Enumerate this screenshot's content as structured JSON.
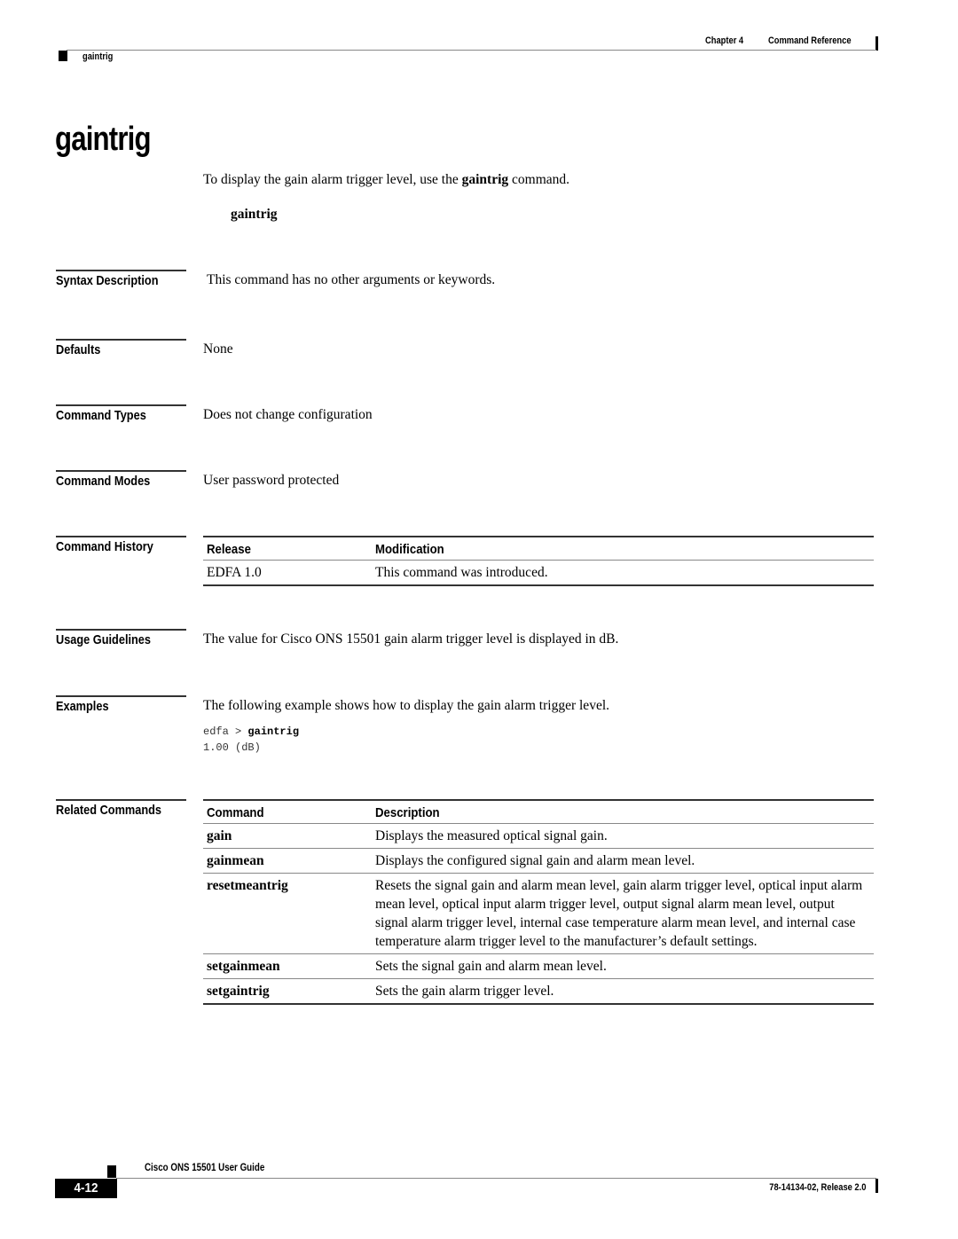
{
  "header": {
    "chapter": "Chapter 4",
    "section": "Command Reference",
    "running_head": "gaintrig"
  },
  "title": "gaintrig",
  "intro": {
    "before": "To display the gain alarm trigger level, use the ",
    "command": "gaintrig",
    "after": " command."
  },
  "syntax": "gaintrig",
  "sections": {
    "syntax_description": {
      "label": "Syntax Description",
      "text": "This command has no other arguments or keywords."
    },
    "defaults": {
      "label": "Defaults",
      "text": "None"
    },
    "command_types": {
      "label": "Command Types",
      "text": "Does not change configuration"
    },
    "command_modes": {
      "label": "Command Modes",
      "text": "User password protected"
    },
    "command_history": {
      "label": "Command History",
      "headers": [
        "Release",
        "Modification"
      ],
      "rows": [
        [
          "EDFA 1.0",
          "This command was introduced."
        ]
      ]
    },
    "usage_guidelines": {
      "label": "Usage Guidelines",
      "text": "The value for Cisco ONS 15501 gain alarm trigger level is displayed in dB."
    },
    "examples": {
      "label": "Examples",
      "text": "The following example shows how to display the gain alarm trigger level.",
      "prompt": "edfa > ",
      "command": "gaintrig",
      "output": "1.00 (dB)"
    },
    "related_commands": {
      "label": "Related Commands",
      "headers": [
        "Command",
        "Description"
      ],
      "rows": [
        [
          "gain",
          "Displays the measured optical signal gain."
        ],
        [
          "gainmean",
          "Displays the configured signal gain and alarm mean level."
        ],
        [
          "resetmeantrig",
          "Resets the signal gain and alarm mean level, gain alarm trigger level, optical input alarm mean level, optical input alarm trigger level, output signal alarm mean level, output signal alarm trigger level, internal case temperature alarm mean level, and internal case temperature alarm trigger level to the manufacturer’s default settings."
        ],
        [
          "setgainmean",
          "Sets the signal gain and alarm mean level."
        ],
        [
          "setgaintrig",
          "Sets the gain alarm trigger level."
        ]
      ]
    }
  },
  "footer": {
    "guide_title": "Cisco ONS 15501 User Guide",
    "page_number": "4-12",
    "release": "78-14134-02, Release 2.0"
  }
}
